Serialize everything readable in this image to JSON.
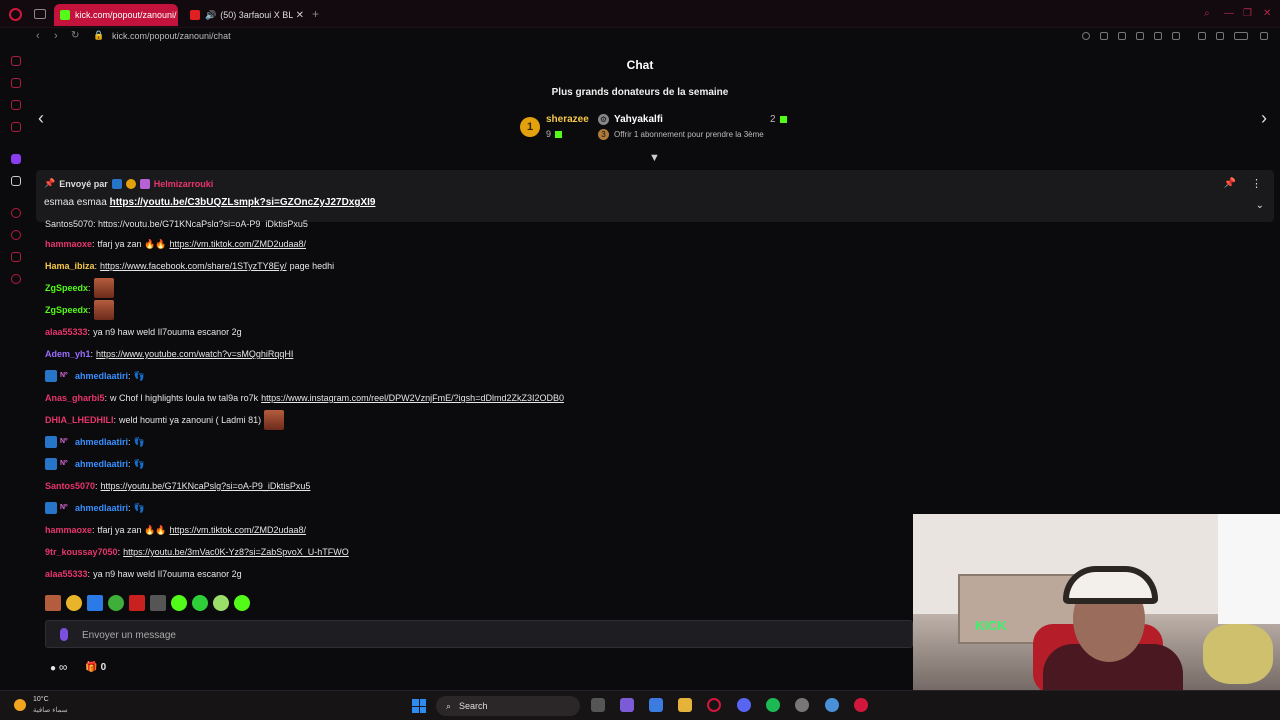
{
  "browser": {
    "tabs": [
      {
        "label": "kick.com/popout/zanouni/",
        "active": true
      },
      {
        "label": "(50) 3arfaoui X BL"
      }
    ],
    "url": "kick.com/popout/zanouni/chat"
  },
  "chat": {
    "title": "Chat",
    "donors_heading": "Plus grands donateurs de la semaine",
    "donors": [
      {
        "rank": "1",
        "name": "sherazee",
        "count": "9"
      },
      {
        "name": "Yahyakalfi",
        "count": "2",
        "subtext_rank": "3",
        "subtext": "Offrir 1 abonnement pour prendre la 3ème"
      }
    ],
    "pinned": {
      "sent_by_label": "Envoyé par",
      "sender": "Helmizarrouki",
      "text": "esmaa esmaa ",
      "link": "https://youtu.be/C3bUQZLsmpk?si=GZOncZyJ27DxgXI9"
    },
    "cutoff_line": "Santos5070: https://youtu.be/G71KNcaPslg?si=oA-P9_iDktisPxu5",
    "messages": [
      {
        "user": "hammaoxe",
        "color": "#e8356c",
        "text": "tfarj ya zan 🔥🔥",
        "link": "https://vm.tiktok.com/ZMD2udaa8/"
      },
      {
        "user": "Hama_ibiza",
        "color": "#f5c84a",
        "link": "https://www.facebook.com/share/1STyzTY8Ey/",
        "text_after": "page hedhi"
      },
      {
        "user": "ZgSpeedx",
        "color": "#53fc18",
        "emote": true
      },
      {
        "user": "ZgSpeedx",
        "color": "#53fc18",
        "emote": true
      },
      {
        "user": "alaa55333",
        "color": "#e8356c",
        "text": "ya n9 haw weld Il7ouuma escanor 2g"
      },
      {
        "user": "Adem_yh1",
        "color": "#9b6bff",
        "link": "https://www.youtube.com/watch?v=sMQghiRqqHI"
      },
      {
        "user": "ahmedlaatiri",
        "color": "#3a8fff",
        "badges": true,
        "text": "👣"
      },
      {
        "user": "Anas_gharbi5",
        "color": "#e8356c",
        "text": "w Chof l highlights loula tw tal9a ro7k",
        "link": "https://www.instagram.com/reel/DPW2VznjFmE/?igsh=dDlmd2ZkZ3I2ODB0"
      },
      {
        "user": "DHIA_LHEDHILI",
        "color": "#e8356c",
        "text": "weld houmti ya zanouni ( Ladmi 81)",
        "emote": true
      },
      {
        "user": "ahmedlaatiri",
        "color": "#3a8fff",
        "badges": true,
        "text": "👣"
      },
      {
        "user": "ahmedlaatiri",
        "color": "#3a8fff",
        "badges": true,
        "text": "👣"
      },
      {
        "user": "Santos5070",
        "color": "#e8356c",
        "link": "https://youtu.be/G71KNcaPslg?si=oA-P9_iDktisPxu5"
      },
      {
        "user": "ahmedlaatiri",
        "color": "#3a8fff",
        "badges": true,
        "text": "👣"
      },
      {
        "user": "hammaoxe",
        "color": "#e8356c",
        "text": "tfarj ya zan 🔥🔥",
        "link": "https://vm.tiktok.com/ZMD2udaa8/"
      },
      {
        "user": "9tr_koussay7050",
        "color": "#e8356c",
        "link": "https://youtu.be/3mVac0K-Yz8?si=ZabSpvoX_U-hTFWO"
      },
      {
        "user": "alaa55333",
        "color": "#e8356c",
        "text": "ya n9 haw weld Il7ouuma escanor 2g"
      }
    ],
    "input_placeholder": "Envoyer un message",
    "footer": {
      "infinity": "∞",
      "gift_count": "0"
    }
  },
  "webcam": {
    "sign": "KICK"
  },
  "taskbar": {
    "weather_temp": "10°C",
    "weather_desc": "سماء صافية",
    "search_label": "Search"
  },
  "colors": {
    "accent": "#53fc18",
    "opera_red": "#c3123c"
  }
}
